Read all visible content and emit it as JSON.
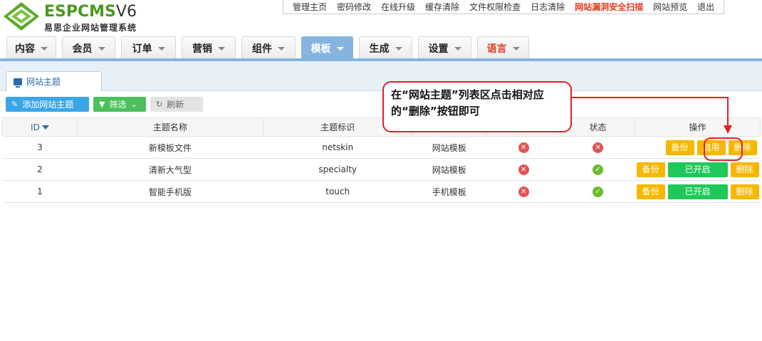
{
  "logo": {
    "brand_esp": "ESP",
    "brand_cms": "CMS",
    "brand_ver": "V6",
    "subtitle": "易思企业网站管理系统"
  },
  "top_nav": [
    "管理主页",
    "密码修改",
    "在线升级",
    "缓存清除",
    "文件权限检查",
    "日志清除",
    "网站漏洞安全扫描",
    "网站预览",
    "退出"
  ],
  "main_nav": [
    {
      "label": "内容",
      "width": 70
    },
    {
      "label": "会员",
      "width": 75
    },
    {
      "label": "订单",
      "width": 77
    },
    {
      "label": "营销",
      "width": 76
    },
    {
      "label": "组件",
      "width": 76
    },
    {
      "label": "模板",
      "width": 75
    },
    {
      "label": "生成",
      "width": 75
    },
    {
      "label": "设置",
      "width": 75
    },
    {
      "label": "语言",
      "width": 73
    }
  ],
  "sub_tab": "网站主题",
  "toolbar": {
    "add": "添加网站主题",
    "filter": "筛选",
    "refresh": "刷新"
  },
  "table": {
    "headers": {
      "id": "ID",
      "name": "主题名称",
      "tag": "主题标识",
      "status": "状态",
      "ops": "操作"
    },
    "rows": [
      {
        "id": "3",
        "name": "新模板文件",
        "tag": "netskin",
        "type": "网站模板",
        "b1": "备份",
        "b2": "启用",
        "b3": "删除"
      },
      {
        "id": "2",
        "name": "清新大气型",
        "tag": "specialty",
        "type": "网站模板",
        "b1": "备份",
        "b2": "已开启",
        "b3": "删除"
      },
      {
        "id": "1",
        "name": "智能手机版",
        "tag": "touch",
        "type": "手机模板",
        "b1": "备份",
        "b2": "已开启",
        "b3": "删除"
      }
    ]
  },
  "callout": {
    "line1": "在“网站主题”列表区点击相对应",
    "line2": "的“删除”按钮即可"
  }
}
